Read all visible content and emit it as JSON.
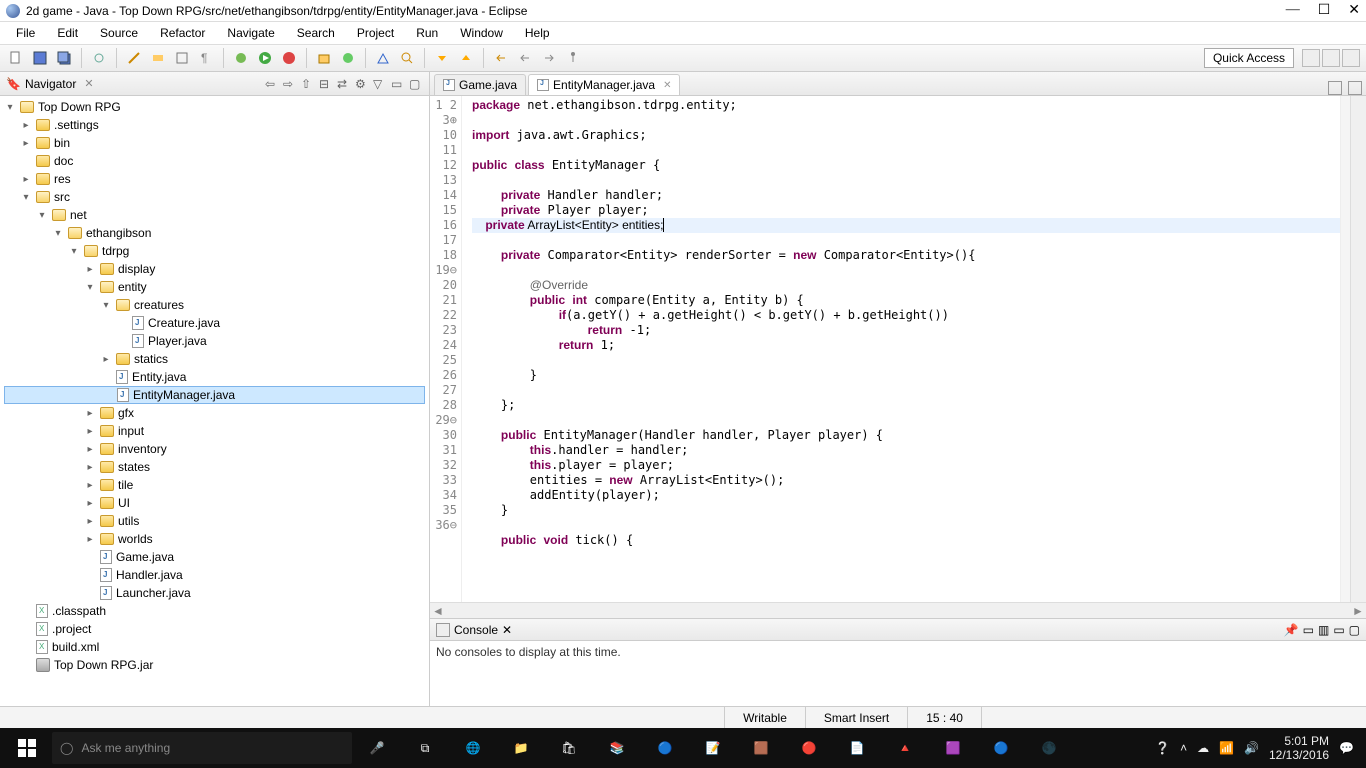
{
  "titlebar": {
    "title": "2d game - Java - Top Down RPG/src/net/ethangibson/tdrpg/entity/EntityManager.java - Eclipse"
  },
  "menubar": [
    "File",
    "Edit",
    "Source",
    "Refactor",
    "Navigate",
    "Search",
    "Project",
    "Run",
    "Window",
    "Help"
  ],
  "toolbar": {
    "quick_access": "Quick Access"
  },
  "navigator": {
    "title": "Navigator",
    "tree": {
      "project": "Top Down RPG",
      "folders_top": [
        ".settings",
        "bin",
        "doc",
        "res"
      ],
      "src": "src",
      "net": "net",
      "ethan": "ethangibson",
      "tdrpg": "tdrpg",
      "display": "display",
      "entity": "entity",
      "creatures": "creatures",
      "creature_java": "Creature.java",
      "player_java": "Player.java",
      "statics": "statics",
      "entity_java": "Entity.java",
      "entitymanager_java": "EntityManager.java",
      "pkgs": [
        "gfx",
        "input",
        "inventory",
        "states",
        "tile",
        "UI",
        "utils",
        "worlds"
      ],
      "tdrpg_files": [
        "Game.java",
        "Handler.java",
        "Launcher.java"
      ],
      "root_files": [
        {
          "name": ".classpath",
          "type": "xml"
        },
        {
          "name": ".project",
          "type": "xml"
        },
        {
          "name": "build.xml",
          "type": "xml"
        },
        {
          "name": "Top Down RPG.jar",
          "type": "jar"
        }
      ]
    }
  },
  "editor": {
    "tabs": [
      {
        "label": "Game.java",
        "active": false
      },
      {
        "label": "EntityManager.java",
        "active": true
      }
    ],
    "lines": [
      1,
      2,
      3,
      10,
      11,
      12,
      13,
      14,
      15,
      16,
      17,
      18,
      19,
      20,
      21,
      22,
      23,
      24,
      25,
      26,
      27,
      28,
      29,
      30,
      31,
      32,
      33,
      34,
      35,
      36
    ]
  },
  "console": {
    "title": "Console",
    "message": "No consoles to display at this time."
  },
  "status": {
    "writable": "Writable",
    "insert": "Smart Insert",
    "pos": "15 : 40"
  },
  "taskbar": {
    "search_placeholder": "Ask me anything",
    "time": "5:01 PM",
    "date": "12/13/2016"
  }
}
